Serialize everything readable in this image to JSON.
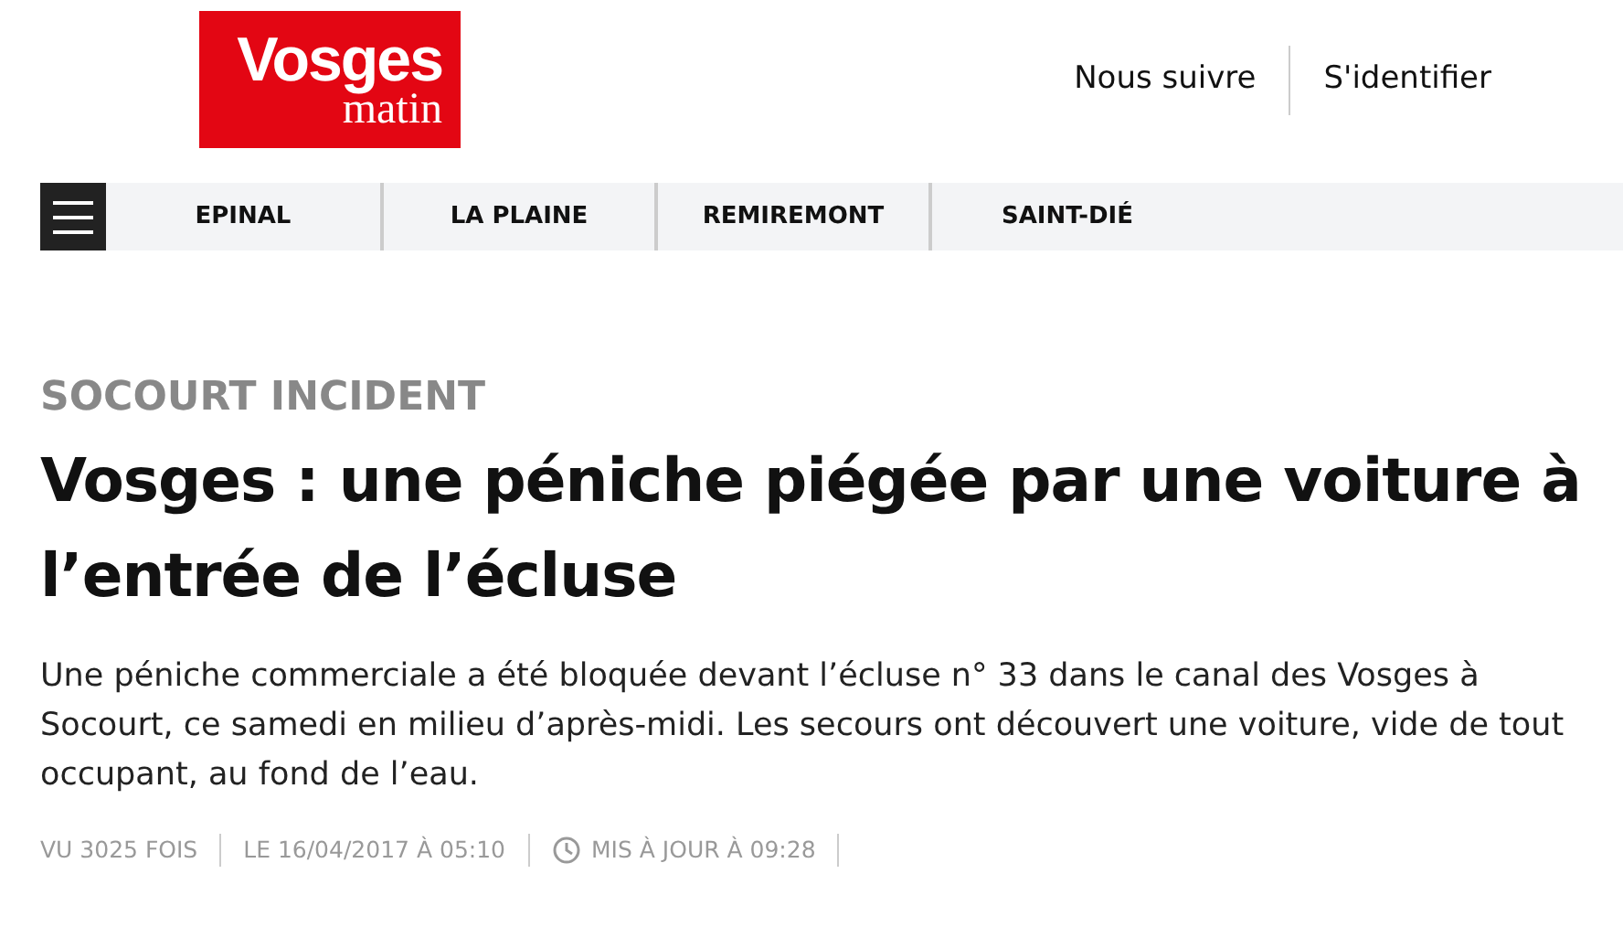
{
  "logo": {
    "line_1": "Vosges",
    "line_2": "matin"
  },
  "header_links": [
    "Nous suivre",
    "S'identifier"
  ],
  "nav": {
    "items": [
      "EPINAL",
      "LA PLAINE",
      "REMIREMONT",
      "SAINT-DIÉ"
    ]
  },
  "article": {
    "kicker": "SOCOURT INCIDENT",
    "title": "Vosges : une péniche piégée par une voiture à l’entrée de l’écluse",
    "summary": "Une péniche commerciale a été bloquée devant l’écluse n° 33 dans le canal des Vosges à Socourt, ce samedi en milieu d’après-midi. Les secours ont découvert une voiture, vide de tout occupant, au fond de l’eau.",
    "meta": [
      {
        "kind": "text",
        "text": "VU 3025 FOIS"
      },
      {
        "kind": "text",
        "text": "LE 16/04/2017 À 05:10"
      },
      {
        "kind": "clock",
        "text": "MIS À JOUR À 09:28"
      }
    ]
  }
}
